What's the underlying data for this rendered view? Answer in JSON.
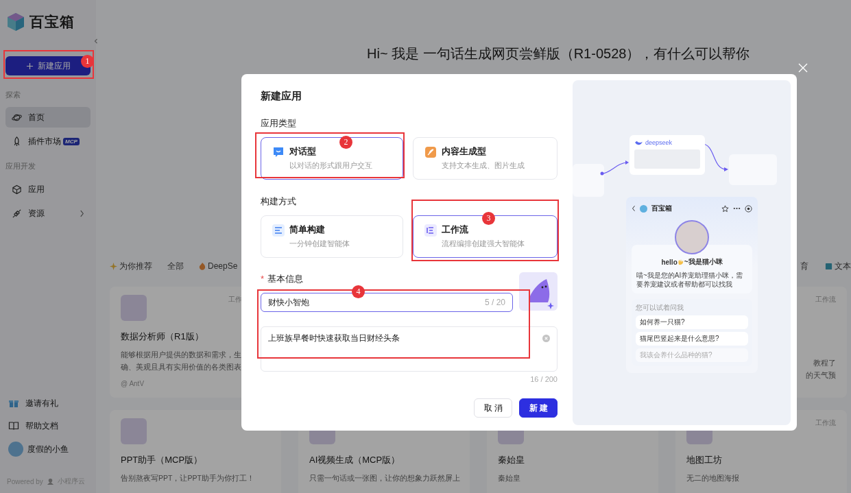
{
  "sidebar": {
    "logo": "百宝箱",
    "new_app_button": "新建应用",
    "groups": [
      {
        "heading": "探索",
        "items": [
          {
            "label": "首页",
            "selected": true,
            "expandable": false
          },
          {
            "label": "插件市场",
            "badge": "MCP",
            "selected": false,
            "expandable": false
          }
        ]
      },
      {
        "heading": "应用开发",
        "items": [
          {
            "label": "应用",
            "selected": false,
            "expandable": false
          },
          {
            "label": "资源",
            "selected": false,
            "expandable": true
          }
        ]
      }
    ],
    "bottom_items": [
      {
        "label": "邀请有礼"
      },
      {
        "label": "帮助文档"
      }
    ],
    "user_name": "度假的小鱼",
    "footer": {
      "powered_by": "Powered by",
      "brand": "小程序云"
    }
  },
  "main": {
    "greeting": "Hi~ 我是 一句话生成网页尝鲜版（R1-0528），有什么可以帮你",
    "filter_tabs_left": [
      {
        "label": "为你推荐"
      },
      {
        "label": "全部"
      },
      {
        "label": "DeepSe"
      }
    ],
    "filter_tabs_right": [
      {
        "label": "育"
      },
      {
        "label": "文本"
      }
    ],
    "card_rows": [
      [
        {
          "title": "数据分析师（R1版）",
          "tag": "工作",
          "desc": [
            "能够根据用户提供的数据和需求，生",
            "确、美观且具有实用价值的各类图表"
          ],
          "author": "@ AntV"
        },
        {},
        {},
        {
          "tag": "工作流",
          "desc": [
            "教程了",
            "的天气预"
          ]
        }
      ],
      [
        {
          "title": "PPT助手（MCP版）",
          "desc": [
            "告别熬夜写PPT，让PPT助手为你打工！"
          ]
        },
        {
          "title": "AI视频生成（MCP版）",
          "desc": [
            "只需一句话或一张图，让你的想象力跃然屏上"
          ]
        },
        {
          "title": "秦始皇",
          "desc": [
            "秦始皇"
          ]
        },
        {
          "title": "地图工坊",
          "tag": "工作流",
          "desc": [
            "无二的地图海报"
          ]
        }
      ]
    ]
  },
  "dialog": {
    "title": "新建应用",
    "type_label": "应用类型",
    "app_types": [
      {
        "title": "对话型",
        "desc": "以对话的形式跟用户交互",
        "selected": true
      },
      {
        "title": "内容生成型",
        "desc": "支持文本生成、图片生成",
        "selected": false
      }
    ],
    "build_label": "构建方式",
    "build_modes": [
      {
        "title": "简单构建",
        "desc": "一分钟创建智能体",
        "selected": false
      },
      {
        "title": "工作流",
        "desc": "流程编排创建强大智能体",
        "selected": true
      }
    ],
    "basic_info": {
      "required_mark": "*",
      "label": "基本信息"
    },
    "name_field": {
      "value": "财快小智炮",
      "counter": "5 / 20",
      "focused": true
    },
    "description_field": {
      "value": "上班族早餐时快速获取当日财经头条",
      "counter": "16 / 200"
    },
    "buttons": {
      "cancel": "取消",
      "create": "新建"
    },
    "preview": {
      "model_name": "deepseek",
      "app_name": "百宝箱",
      "hello_before": "hello",
      "hello_after": "~我是猫小咪",
      "intro": "喵~我是您的AI养宠助理猫小咪，需要养宠建议或者帮助都可以找我",
      "suggest_label": "您可以试着问我",
      "suggestions": [
        "如何养一只猫?",
        "猫尾巴竖起来是什么意思?",
        "我该会养什么品种的猫?"
      ]
    }
  },
  "annotations": [
    "1",
    "2",
    "3",
    "4"
  ]
}
